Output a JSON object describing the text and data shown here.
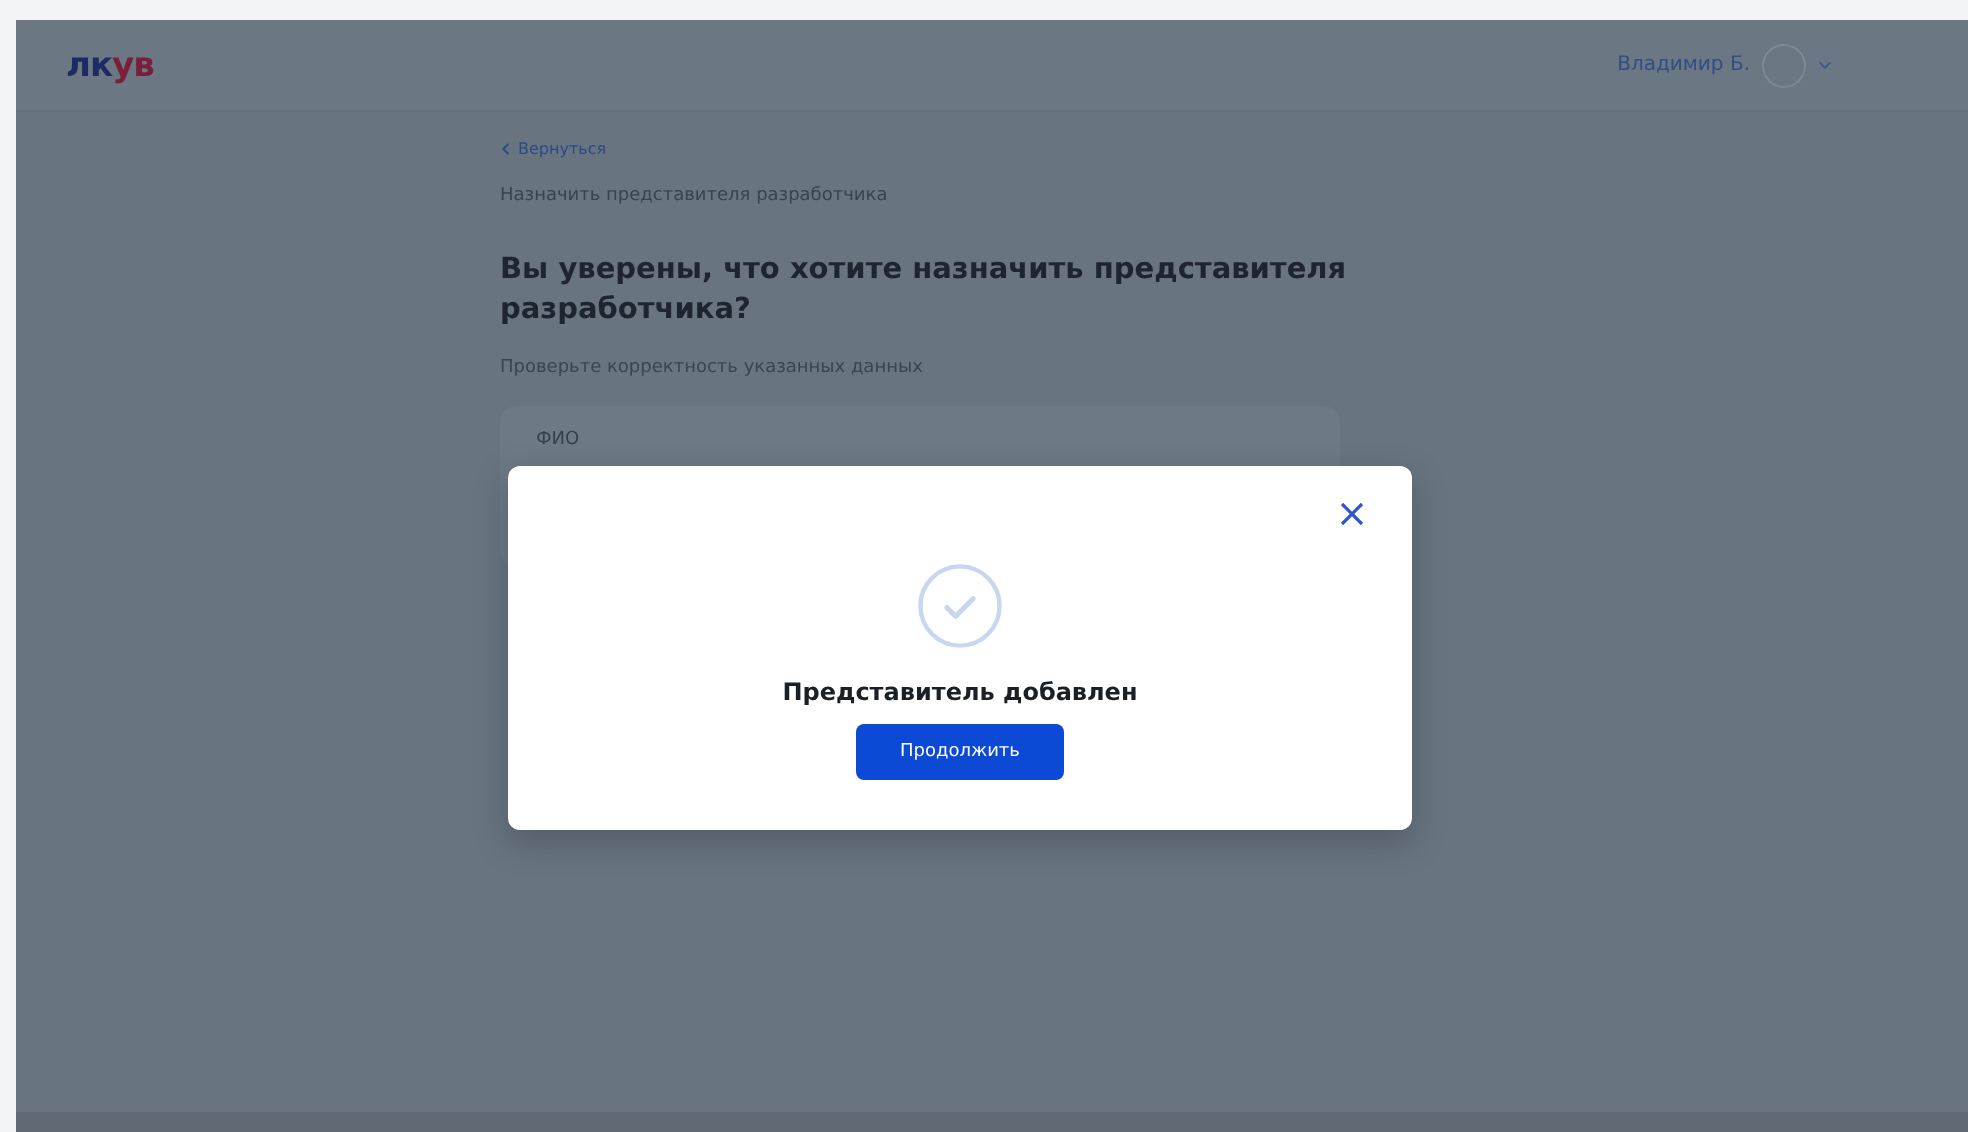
{
  "header": {
    "logo": [
      {
        "text": "лк",
        "color": "#1d2a66"
      },
      {
        "text": "ув",
        "color": "#7a1f3a"
      }
    ],
    "user_name": "Владимир Б."
  },
  "back_link": "Вернуться",
  "breadcrumb": "Назначить представителя разработчика",
  "heading": "Вы уверены, что хотите назначить представителя разработчика?",
  "hint": "Проверьте корректность указанных данных",
  "card": {
    "field_label": "ФИО"
  },
  "modal": {
    "message": "Представитель добавлен",
    "button": "Продолжить"
  }
}
